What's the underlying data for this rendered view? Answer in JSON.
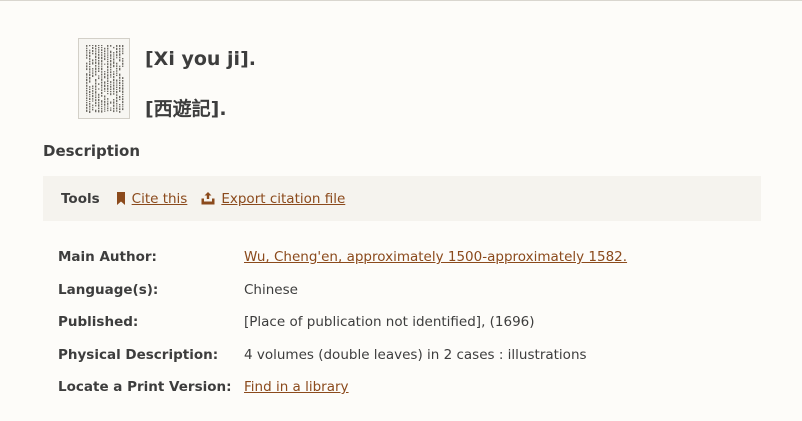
{
  "record": {
    "title_romanized": "[Xi you ji].",
    "title_original": "[西遊記].",
    "thumbnail_icon": "book-page-thumbnail"
  },
  "description": {
    "heading": "Description"
  },
  "tools": {
    "label": "Tools",
    "cite_label": "Cite this",
    "cite_icon": "bookmark-icon",
    "export_label": "Export citation file",
    "export_icon": "export-tray-icon"
  },
  "details": [
    {
      "label": "Main Author:",
      "value": "Wu, Cheng'en, approximately 1500-approximately 1582.",
      "link": true
    },
    {
      "label": "Language(s):",
      "value": "Chinese",
      "link": false
    },
    {
      "label": "Published:",
      "value": "[Place of publication not identified], (1696)",
      "link": false
    },
    {
      "label": "Physical Description:",
      "value": "4 volumes (double leaves) in 2 cases : illustrations",
      "link": false
    },
    {
      "label": "Locate a Print Version:",
      "value": "Find in a library",
      "link": true
    }
  ],
  "colors": {
    "link": "#8b4a1c",
    "background": "#fdfcf9",
    "toolbar_bg": "#f5f3ee",
    "text": "#3d3d3d"
  }
}
